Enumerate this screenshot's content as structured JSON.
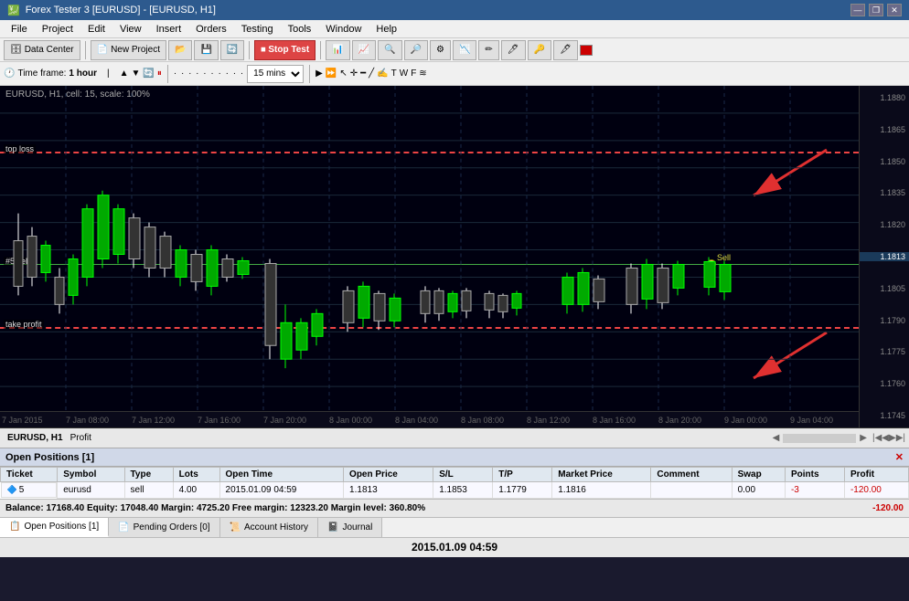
{
  "titleBar": {
    "title": "Forex Tester 3 [EURUSD] - [EURUSD, H1]",
    "winBtns": [
      "—",
      "❐",
      "✕"
    ]
  },
  "menuBar": {
    "items": [
      "File",
      "Project",
      "Edit",
      "View",
      "Insert",
      "Orders",
      "Testing",
      "Tools",
      "Window",
      "Help"
    ]
  },
  "toolbar1": {
    "dataCenter": "Data Center",
    "newProject": "New Project",
    "stopTest": "Stop Test"
  },
  "toolbar2": {
    "timeframeLabel": "Time frame:",
    "timeframeValue": "1 hour",
    "speedValue": "15 mins"
  },
  "chart": {
    "label": "EURUSD, H1, cell: 15, scale: 100%",
    "stopLossLabel": "top loss",
    "takeProfitLabel": "take profit",
    "sellLabel": "#5 sell",
    "sellDotLabel": "Sell",
    "prices": [
      "1.1880",
      "1.1865",
      "1.1850",
      "1.1835",
      "1.1820",
      "1.1813",
      "1.1805",
      "1.1790",
      "1.1775",
      "1.1760",
      "1.1745"
    ],
    "timeLabels": [
      "7 Jan 2015",
      "7 Jan 08:00",
      "7 Jan 12:00",
      "7 Jan 16:00",
      "7 Jan 20:00",
      "8 Jan 00:00",
      "8 Jan 04:00",
      "8 Jan 08:00",
      "8 Jan 12:00",
      "8 Jan 16:00",
      "8 Jan 20:00",
      "9 Jan 00:00",
      "9 Jan 04:00"
    ]
  },
  "bottomTabsBar": {
    "pair": "EURUSD, H1",
    "profitTab": "Profit"
  },
  "openPositions": {
    "title": "Open Positions [1]",
    "columns": [
      "Ticket",
      "Symbol",
      "Type",
      "Lots",
      "Open Time",
      "Open Price",
      "S/L",
      "T/P",
      "Market Price",
      "Comment",
      "Swap",
      "Points",
      "Profit"
    ],
    "rows": [
      {
        "ticket": "5",
        "symbol": "eurusd",
        "type": "sell",
        "lots": "4.00",
        "openTime": "2015.01.09 04:59",
        "openPrice": "1.1813",
        "sl": "1.1853",
        "tp": "1.1779",
        "marketPrice": "1.1816",
        "comment": "",
        "swap": "0.00",
        "points": "-3",
        "profit": "-120.00"
      }
    ]
  },
  "balanceBar": {
    "text": "Balance: 17168.40  Equity: 17048.40  Margin: 4725.20  Free margin: 12323.20  Margin level: 360.80%",
    "rightValue": "-120.00"
  },
  "bottomTabs": {
    "tabs": [
      "Open Positions [1]",
      "Pending Orders [0]",
      "Account History",
      "Journal"
    ]
  },
  "dateBar": {
    "date": "2015.01.09 04:59"
  }
}
